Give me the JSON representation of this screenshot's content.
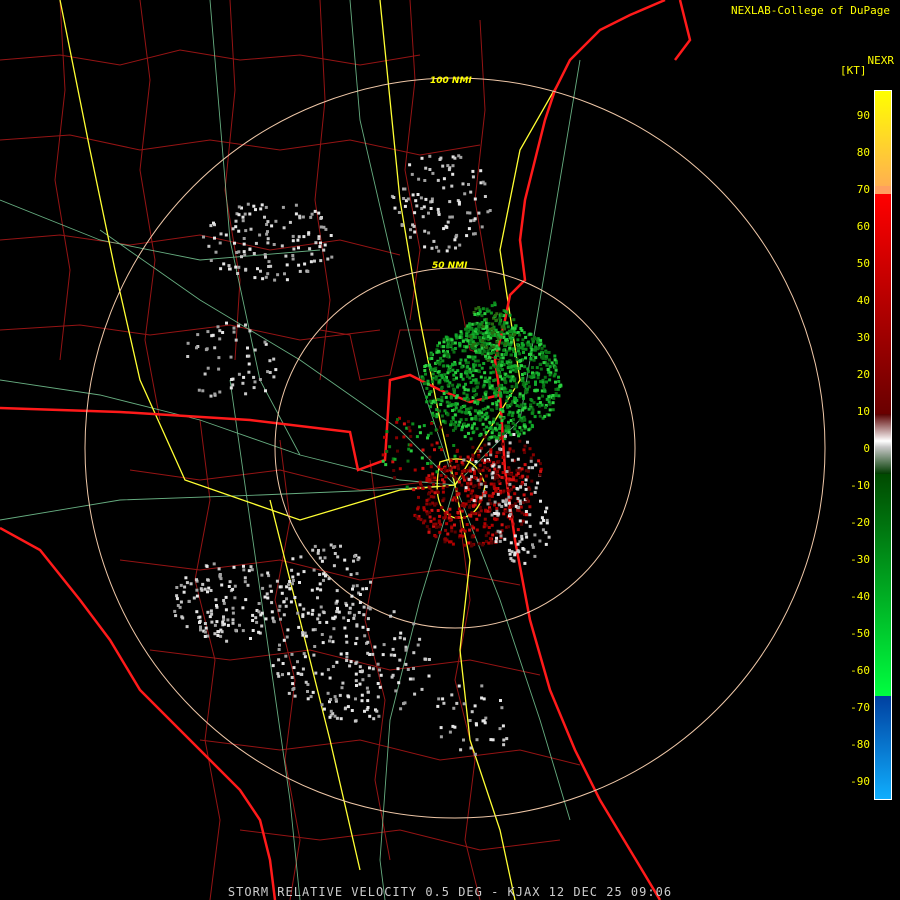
{
  "header": {
    "credit": "NEXLAB-College of DuPage",
    "product": "NEXR",
    "units": "[KT]"
  },
  "footer": {
    "caption": "STORM RELATIVE VELOCITY 0.5 DEG - KJAX 12 DEC 25 09:06"
  },
  "map": {
    "radar_site": "KJAX",
    "range_rings": [
      {
        "label": "50 NMI"
      },
      {
        "label": "100 NMI"
      }
    ],
    "colors": {
      "state_border": "#ff1a1a",
      "county_border": "#b01818",
      "highway": "#ffff33",
      "road": "#80d8a0",
      "range_ring": "#f0c8a8"
    }
  },
  "legend": {
    "ticks": [
      "90",
      "80",
      "70",
      "60",
      "50",
      "40",
      "30",
      "20",
      "10",
      "0",
      "-10",
      "-20",
      "-30",
      "-40",
      "-50",
      "-60",
      "-70",
      "-80",
      "-90"
    ],
    "colors": {
      "top_yellow": "#ffff00",
      "orange": "#ffa060",
      "red": "#ff0000",
      "dark_red": "#6a0000",
      "gray": "#c8c8c8",
      "dark_green": "#004a00",
      "green": "#00ff40",
      "dark_blue": "#0050b0",
      "light_blue": "#10b0ff"
    }
  }
}
